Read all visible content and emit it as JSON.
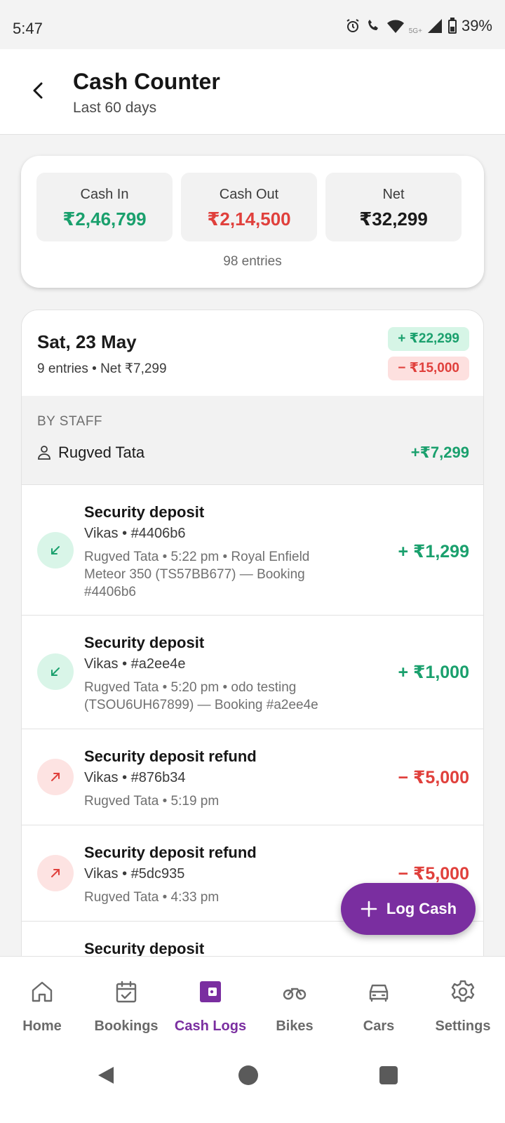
{
  "status_bar": {
    "time": "5:47",
    "network": "5G+",
    "battery": "39%"
  },
  "header": {
    "title": "Cash Counter",
    "subtitle": "Last 60 days"
  },
  "summary": {
    "cash_in_label": "Cash In",
    "cash_in_value": "₹2,46,799",
    "cash_out_label": "Cash Out",
    "cash_out_value": "₹2,14,500",
    "net_label": "Net",
    "net_value": "₹32,299",
    "entries": "98 entries"
  },
  "day": {
    "title": "Sat, 23 May",
    "subtitle": "9 entries • Net ₹7,299",
    "in_pill": "+ ₹22,299",
    "out_pill": "− ₹15,000",
    "staff_heading": "BY STAFF",
    "staff_name": "Rugved Tata",
    "staff_net": "+₹7,299"
  },
  "transactions": [
    {
      "title": "Security deposit",
      "sub": "Vikas • #4406b6",
      "meta": "Rugved Tata • 5:22 pm  •  Royal Enfield Meteor 350 (TS57BB677) — Booking #4406b6",
      "amount": "+ ₹1,299",
      "direction": "in"
    },
    {
      "title": "Security deposit",
      "sub": "Vikas • #a2ee4e",
      "meta": "Rugved Tata • 5:20 pm  •  odo testing (TSOU6UH67899) — Booking #a2ee4e",
      "amount": "+ ₹1,000",
      "direction": "in"
    },
    {
      "title": "Security deposit refund",
      "sub": "Vikas • #876b34",
      "meta": "Rugved Tata • 5:19 pm",
      "amount": "− ₹5,000",
      "direction": "out"
    },
    {
      "title": "Security deposit refund",
      "sub": "Vikas • #5dc935",
      "meta": "Rugved Tata • 4:33 pm",
      "amount": "− ₹5,000",
      "direction": "out"
    },
    {
      "title": "Security deposit"
    }
  ],
  "fab": {
    "label": "Log Cash"
  },
  "nav": [
    {
      "label": "Home",
      "icon": "home-icon"
    },
    {
      "label": "Bookings",
      "icon": "calendar-check-icon"
    },
    {
      "label": "Cash Logs",
      "icon": "wallet-icon"
    },
    {
      "label": "Bikes",
      "icon": "bike-icon"
    },
    {
      "label": "Cars",
      "icon": "car-icon"
    },
    {
      "label": "Settings",
      "icon": "gear-icon"
    }
  ],
  "colors": {
    "accent": "#7a2ea0",
    "green": "#1aa06d",
    "red": "#e0403c"
  }
}
